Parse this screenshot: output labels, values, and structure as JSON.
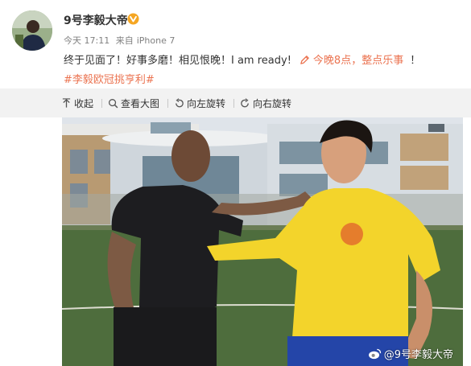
{
  "post": {
    "author": "9号李毅大帝",
    "meta": {
      "time": "今天 17:11",
      "source_prefix": "来自",
      "source": "iPhone 7"
    },
    "text": "终于见面了！好事多磨！相见恨晚！I am ready!",
    "link_text": "今晚8点，整点乐事",
    "tail": "！",
    "hashtag": "#李毅欧冠挑亨利#"
  },
  "toolbar": {
    "collapse": "收起",
    "view_large": "查看大图",
    "rotate_left": "向左旋转",
    "rotate_right": "向右旋转"
  },
  "photo": {
    "watermark": "@9号李毅大帝"
  },
  "icons": {
    "verified": "verified-badge-icon",
    "link": "pen-link-icon",
    "collapse": "collapse-arrow-icon",
    "zoom": "magnifier-icon",
    "rotate_left": "rotate-left-icon",
    "rotate_right": "rotate-right-icon",
    "weibo": "weibo-logo-icon"
  },
  "colors": {
    "accent": "#eb7350",
    "badge": "#f5a623",
    "toolbar_bg": "#f2f2f2",
    "meta_text": "#808080"
  }
}
